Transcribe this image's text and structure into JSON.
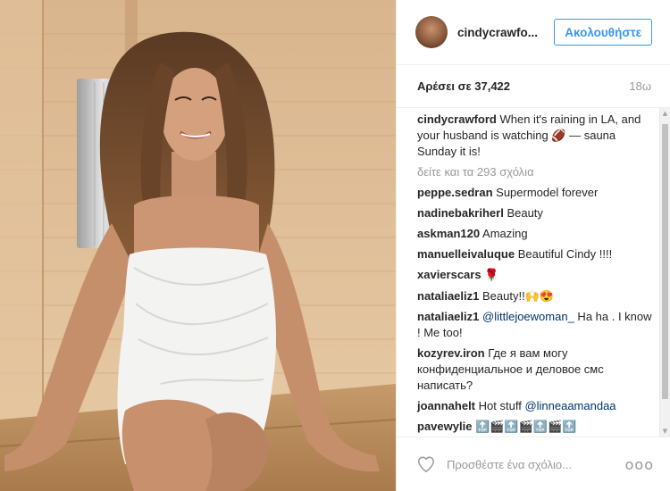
{
  "post": {
    "photo_alt": "",
    "header": {
      "username": "cindycrawfo...",
      "follow_label": "Ακολουθήστε"
    },
    "meta": {
      "likes": "Αρέσει σε 37,422",
      "age": "18ω"
    },
    "caption": {
      "user": "cindycrawford",
      "text": "When it's raining in LA, and your husband is watching 🏈 — sauna Sunday it is!"
    },
    "view_all": "δείτε και τα 293 σχόλια",
    "comments": [
      {
        "user": "peppe.sedran",
        "text": "Supermodel forever"
      },
      {
        "user": "nadinebakriherl",
        "text": "Beauty"
      },
      {
        "user": "askman120",
        "text": "Amazing"
      },
      {
        "user": "manuelleivaluque",
        "text": "Beautiful Cindy !!!!"
      },
      {
        "user": "xavierscars",
        "text": "🌹"
      },
      {
        "user": "nataliaeliz1",
        "text": "Beauty!!🙌😍"
      },
      {
        "user": "nataliaeliz1",
        "mention": "@littlejoewoman_",
        "text": " Ha ha . I know ! Me too!"
      },
      {
        "user": "kozyrev.iron",
        "text": "Где я вам могу конфиденциальное и деловое смс написать?"
      },
      {
        "user": "joannahelt",
        "text": "Hot stuff ",
        "mention": "@linneaamandaa"
      },
      {
        "user": "pavewylie",
        "text": "🔝🎬🔝🎬🔝🎬🔝"
      }
    ],
    "footer": {
      "comment_placeholder": "Προσθέστε ένα σχόλιο...",
      "more_label": "ooo"
    },
    "icons": {
      "like": "heart-icon",
      "more": "more-options-icon"
    },
    "colors": {
      "accent": "#3897f0",
      "muted": "#999999",
      "text": "#262626"
    }
  }
}
